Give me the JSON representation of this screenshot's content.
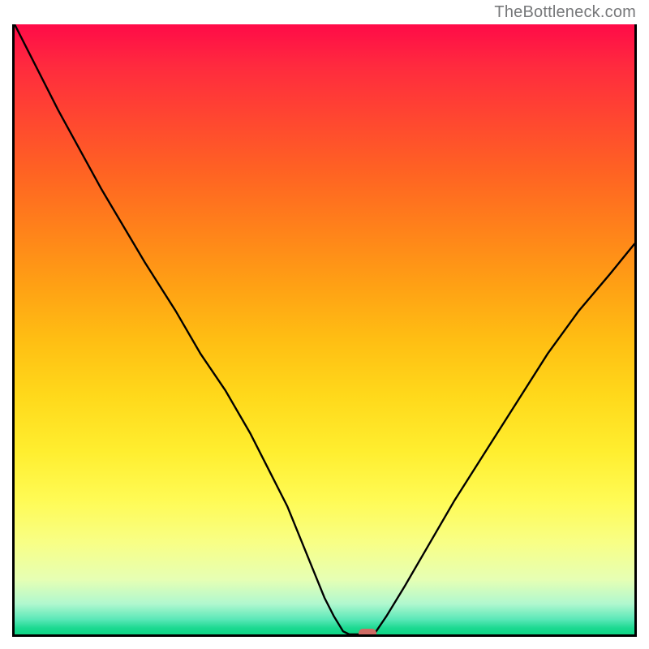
{
  "watermark": "TheBottleneck.com",
  "chart_data": {
    "type": "line",
    "title": "",
    "xlabel": "",
    "ylabel": "",
    "xlim": [
      0,
      100
    ],
    "ylim": [
      0,
      100
    ],
    "grid": false,
    "series": [
      {
        "name": "left-branch",
        "x": [
          0,
          7,
          14,
          21,
          26,
          30,
          34,
          38,
          41,
          44,
          46,
          48,
          50,
          51.5,
          53,
          54
        ],
        "y": [
          100,
          86,
          73,
          61,
          53,
          46,
          40,
          33,
          27,
          21,
          16,
          11,
          6,
          3,
          0.5,
          0
        ]
      },
      {
        "name": "valley-floor",
        "x": [
          54,
          58
        ],
        "y": [
          0,
          0
        ]
      },
      {
        "name": "right-branch",
        "x": [
          58,
          60,
          63,
          67,
          71,
          76,
          81,
          86,
          91,
          96,
          100
        ],
        "y": [
          0,
          3,
          8,
          15,
          22,
          30,
          38,
          46,
          53,
          59,
          64
        ]
      }
    ],
    "marker": {
      "x": 56.5,
      "y": 0.6
    },
    "gradient_stops": [
      {
        "pos": 0,
        "color": "#ff0b48"
      },
      {
        "pos": 50,
        "color": "#ffcf17"
      },
      {
        "pos": 80,
        "color": "#fdff70"
      },
      {
        "pos": 100,
        "color": "#0fd686"
      }
    ]
  }
}
